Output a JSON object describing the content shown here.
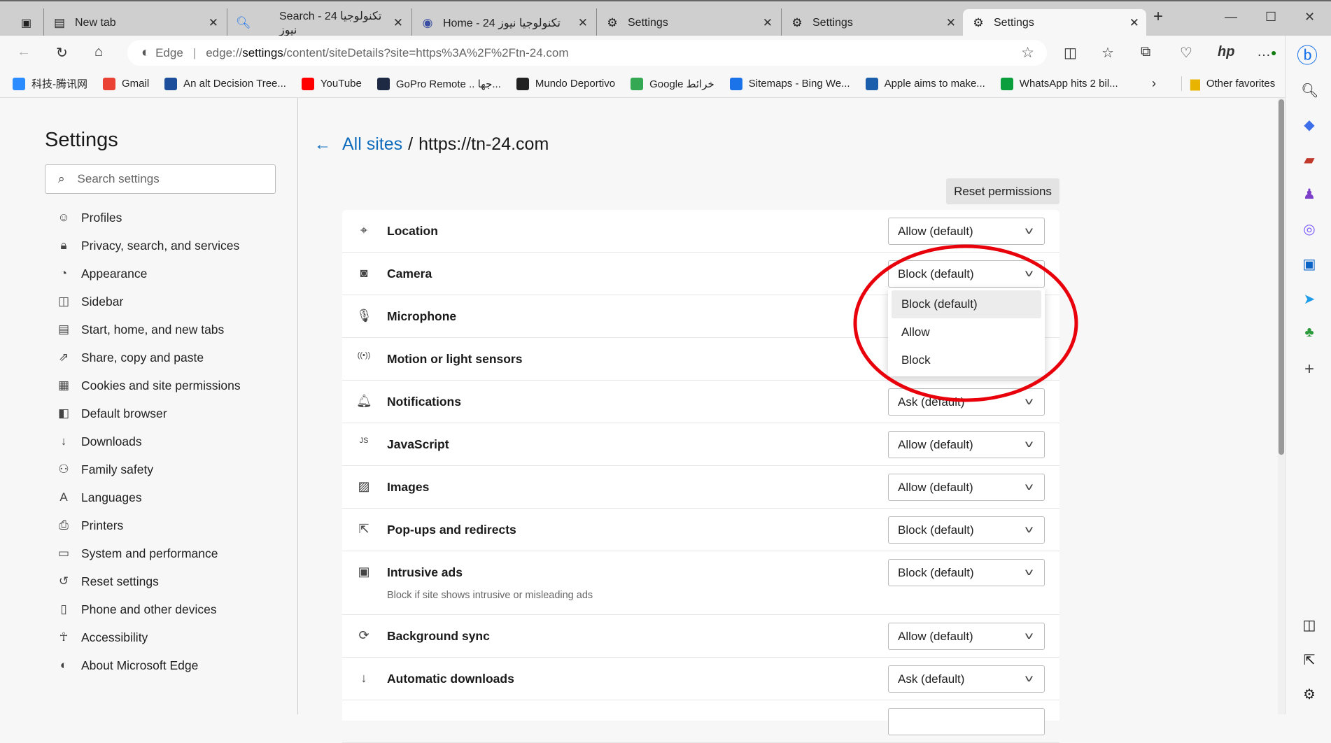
{
  "browser": {
    "tabs": [
      {
        "label": "New tab",
        "icon": "new-tab-icon"
      },
      {
        "label": "Search - 24 تكنولوجيا نيوز",
        "icon": "search-icon"
      },
      {
        "label": "Home - 24 تكنولوجيا نيوز",
        "icon": "site-icon"
      },
      {
        "label": "Settings",
        "icon": "gear-icon"
      },
      {
        "label": "Settings",
        "icon": "gear-icon"
      },
      {
        "label": "Settings",
        "icon": "gear-icon",
        "active": true
      }
    ],
    "address": {
      "brand": "Edge",
      "prefix": "edge://",
      "domain": "settings",
      "rest": "/content/siteDetails?site=https%3A%2F%2Ftn-24.com"
    },
    "bookmarks": [
      {
        "label": "科技-腾讯网",
        "color": "#2a8cff"
      },
      {
        "label": "Gmail",
        "color": "#ea4335"
      },
      {
        "label": "An alt Decision Tree...",
        "color": "#1d4e9c"
      },
      {
        "label": "YouTube",
        "color": "#ff0000"
      },
      {
        "label": "GoPro Remote .. جها...",
        "color": "#1e2a44"
      },
      {
        "label": "Mundo Deportivo",
        "color": "#222222"
      },
      {
        "label": "Google خرائط",
        "color": "#34a853"
      },
      {
        "label": "Sitemaps - Bing We...",
        "color": "#1a73e8"
      },
      {
        "label": "Apple aims to make...",
        "color": "#1b5eab"
      },
      {
        "label": "WhatsApp hits 2 bil...",
        "color": "#0a9e3c"
      }
    ],
    "other_favorites": "Other favorites"
  },
  "settings": {
    "title": "Settings",
    "search_placeholder": "Search settings",
    "nav": [
      {
        "label": "Profiles",
        "icon": "profile-icon"
      },
      {
        "label": "Privacy, search, and services",
        "icon": "lock-icon"
      },
      {
        "label": "Appearance",
        "icon": "palette-icon"
      },
      {
        "label": "Sidebar",
        "icon": "sidebar-icon"
      },
      {
        "label": "Start, home, and new tabs",
        "icon": "home-tabs-icon"
      },
      {
        "label": "Share, copy and paste",
        "icon": "share-icon"
      },
      {
        "label": "Cookies and site permissions",
        "icon": "cookies-icon"
      },
      {
        "label": "Default browser",
        "icon": "browser-icon"
      },
      {
        "label": "Downloads",
        "icon": "download-icon"
      },
      {
        "label": "Family safety",
        "icon": "family-icon"
      },
      {
        "label": "Languages",
        "icon": "language-icon"
      },
      {
        "label": "Printers",
        "icon": "printer-icon"
      },
      {
        "label": "System and performance",
        "icon": "laptop-icon"
      },
      {
        "label": "Reset settings",
        "icon": "reset-icon"
      },
      {
        "label": "Phone and other devices",
        "icon": "phone-icon"
      },
      {
        "label": "Accessibility",
        "icon": "accessibility-icon"
      },
      {
        "label": "About Microsoft Edge",
        "icon": "edge-icon"
      }
    ]
  },
  "main": {
    "breadcrumb_link": "All sites",
    "breadcrumb_sep": "/",
    "site": "https://tn-24.com",
    "reset_label": "Reset permissions",
    "permissions": [
      {
        "label": "Location",
        "value": "Allow (default)",
        "icon": "location-icon"
      },
      {
        "label": "Camera",
        "value": "Block (default)",
        "icon": "camera-icon"
      },
      {
        "label": "Microphone",
        "value": "",
        "icon": "microphone-icon"
      },
      {
        "label": "Motion or light sensors",
        "value": "",
        "icon": "sensor-icon"
      },
      {
        "label": "Notifications",
        "value": "Ask (default)",
        "icon": "bell-icon"
      },
      {
        "label": "JavaScript",
        "value": "Allow (default)",
        "icon": "javascript-icon"
      },
      {
        "label": "Images",
        "value": "Allow (default)",
        "icon": "image-icon"
      },
      {
        "label": "Pop-ups and redirects",
        "value": "Block (default)",
        "icon": "popup-icon"
      },
      {
        "label": "Intrusive ads",
        "value": "Block (default)",
        "icon": "ads-icon",
        "description": "Block if site shows intrusive or misleading ads"
      },
      {
        "label": "Background sync",
        "value": "Allow (default)",
        "icon": "sync-icon"
      },
      {
        "label": "Automatic downloads",
        "value": "Ask (default)",
        "icon": "download-icon"
      }
    ],
    "camera_dropdown": {
      "options": [
        "Block (default)",
        "Allow",
        "Block"
      ],
      "highlighted": "Block (default)"
    }
  },
  "annotation": {
    "color": "#e8000b",
    "shape": "ellipse"
  },
  "colors": {
    "accent": "#0f6cbd"
  }
}
